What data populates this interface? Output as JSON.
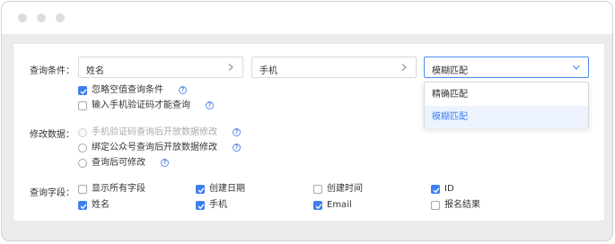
{
  "query_conditions": {
    "label": "查询条件：",
    "field1": "姓名",
    "field2": "手机",
    "match_select": {
      "value": "模糊匹配",
      "options": [
        "精确匹配",
        "模糊匹配"
      ],
      "active_option": "模糊匹配"
    },
    "checkbox_ignore_empty": {
      "label": "忽略空值查询条件",
      "checked": true
    },
    "checkbox_require_code": {
      "label": "输入手机验证码才能查询",
      "checked": false
    }
  },
  "modify_data": {
    "label": "修改数据：",
    "options": [
      {
        "label": "手机验证码查询后开放数据修改",
        "disabled": true
      },
      {
        "label": "绑定公众号查询后开放数据修改",
        "disabled": false
      },
      {
        "label": "查询后可修改",
        "disabled": false
      }
    ]
  },
  "query_fields": {
    "label": "查询字段：",
    "items": [
      {
        "label": "显示所有字段",
        "checked": false
      },
      {
        "label": "创建日期",
        "checked": true
      },
      {
        "label": "创建时间",
        "checked": false
      },
      {
        "label": "ID",
        "checked": true
      },
      {
        "label": "姓名",
        "checked": true
      },
      {
        "label": "手机",
        "checked": true
      },
      {
        "label": "Email",
        "checked": true
      },
      {
        "label": "报名结果",
        "checked": false
      }
    ]
  },
  "help_glyph": "?",
  "colors": {
    "accent": "#3d7ff0",
    "window_bg": "#ececec",
    "dot": "#dcdcdc"
  }
}
